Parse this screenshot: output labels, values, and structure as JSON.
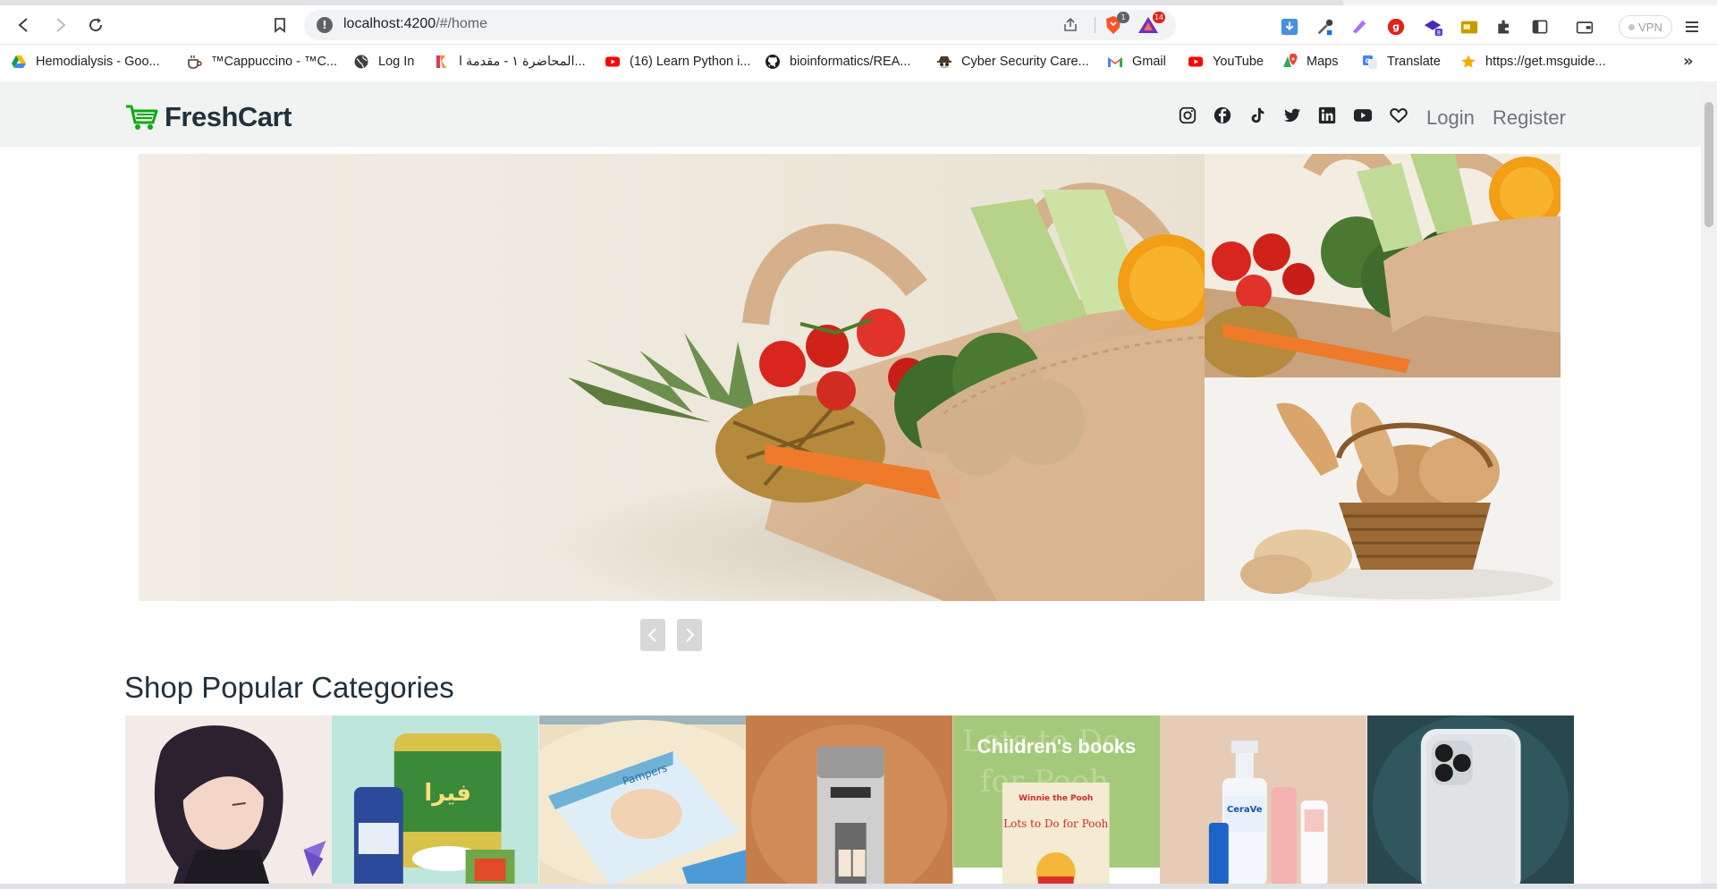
{
  "browser": {
    "url_host": "localhost:4200",
    "url_path": "/#/home",
    "vpn_label": "VPN",
    "brave_shield_count": "1",
    "rewards_count": "14",
    "extension_badge": "8",
    "bookmarks": [
      {
        "label": "Hemodialysis - Goo...",
        "icon": "google-drive-icon"
      },
      {
        "label": "™Cappuccino - ™C...",
        "icon": "coffee-icon"
      },
      {
        "label": "Log In",
        "icon": "globe-icon"
      },
      {
        "label": "المحاضرة ١ - مقدمة ا...",
        "icon": "app-icon"
      },
      {
        "label": "(16) Learn Python i...",
        "icon": "youtube-icon"
      },
      {
        "label": "bioinformatics/REA...",
        "icon": "github-icon"
      },
      {
        "label": "Cyber Security Care...",
        "icon": "spy-icon"
      },
      {
        "label": "Gmail",
        "icon": "gmail-icon"
      },
      {
        "label": "YouTube",
        "icon": "youtube-icon"
      },
      {
        "label": "Maps",
        "icon": "maps-icon"
      },
      {
        "label": "Translate",
        "icon": "translate-icon"
      },
      {
        "label": "https://get.msguide...",
        "icon": "star-icon"
      }
    ],
    "bookmarks_more": "»"
  },
  "site": {
    "brand": "FreshCart",
    "brand_color": "#0aad0a",
    "nav_links": {
      "login": "Login",
      "register": "Register"
    },
    "social_icons": [
      "instagram-icon",
      "facebook-icon",
      "tiktok-icon",
      "twitter-icon",
      "linkedin-icon",
      "youtube-icon",
      "heart-icon"
    ]
  },
  "home": {
    "section_title": "Shop Popular Categories",
    "categories": [
      {
        "name": "category-art"
      },
      {
        "name": "category-grocery"
      },
      {
        "name": "category-baby"
      },
      {
        "name": "category-electronics"
      },
      {
        "name": "category-books",
        "label": "Children's books",
        "book_title_1": "Winnie the Pooh",
        "book_title_2": "Lots to Do for Pooh"
      },
      {
        "name": "category-beauty",
        "brand": "CeraVe"
      },
      {
        "name": "category-mobiles"
      }
    ]
  }
}
